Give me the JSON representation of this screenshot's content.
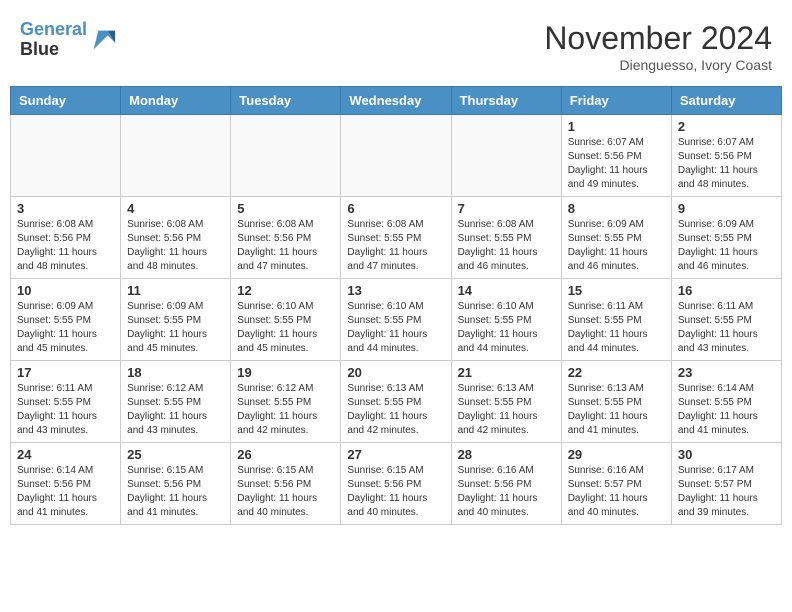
{
  "header": {
    "logo_line1": "General",
    "logo_line2": "Blue",
    "month": "November 2024",
    "location": "Dienguesso, Ivory Coast"
  },
  "weekdays": [
    "Sunday",
    "Monday",
    "Tuesday",
    "Wednesday",
    "Thursday",
    "Friday",
    "Saturday"
  ],
  "weeks": [
    [
      {
        "day": "",
        "empty": true
      },
      {
        "day": "",
        "empty": true
      },
      {
        "day": "",
        "empty": true
      },
      {
        "day": "",
        "empty": true
      },
      {
        "day": "",
        "empty": true
      },
      {
        "day": "1",
        "sunrise": "6:07 AM",
        "sunset": "5:56 PM",
        "daylight": "11 hours and 49 minutes."
      },
      {
        "day": "2",
        "sunrise": "6:07 AM",
        "sunset": "5:56 PM",
        "daylight": "11 hours and 48 minutes."
      }
    ],
    [
      {
        "day": "3",
        "sunrise": "6:08 AM",
        "sunset": "5:56 PM",
        "daylight": "11 hours and 48 minutes."
      },
      {
        "day": "4",
        "sunrise": "6:08 AM",
        "sunset": "5:56 PM",
        "daylight": "11 hours and 48 minutes."
      },
      {
        "day": "5",
        "sunrise": "6:08 AM",
        "sunset": "5:56 PM",
        "daylight": "11 hours and 47 minutes."
      },
      {
        "day": "6",
        "sunrise": "6:08 AM",
        "sunset": "5:55 PM",
        "daylight": "11 hours and 47 minutes."
      },
      {
        "day": "7",
        "sunrise": "6:08 AM",
        "sunset": "5:55 PM",
        "daylight": "11 hours and 46 minutes."
      },
      {
        "day": "8",
        "sunrise": "6:09 AM",
        "sunset": "5:55 PM",
        "daylight": "11 hours and 46 minutes."
      },
      {
        "day": "9",
        "sunrise": "6:09 AM",
        "sunset": "5:55 PM",
        "daylight": "11 hours and 46 minutes."
      }
    ],
    [
      {
        "day": "10",
        "sunrise": "6:09 AM",
        "sunset": "5:55 PM",
        "daylight": "11 hours and 45 minutes."
      },
      {
        "day": "11",
        "sunrise": "6:09 AM",
        "sunset": "5:55 PM",
        "daylight": "11 hours and 45 minutes."
      },
      {
        "day": "12",
        "sunrise": "6:10 AM",
        "sunset": "5:55 PM",
        "daylight": "11 hours and 45 minutes."
      },
      {
        "day": "13",
        "sunrise": "6:10 AM",
        "sunset": "5:55 PM",
        "daylight": "11 hours and 44 minutes."
      },
      {
        "day": "14",
        "sunrise": "6:10 AM",
        "sunset": "5:55 PM",
        "daylight": "11 hours and 44 minutes."
      },
      {
        "day": "15",
        "sunrise": "6:11 AM",
        "sunset": "5:55 PM",
        "daylight": "11 hours and 44 minutes."
      },
      {
        "day": "16",
        "sunrise": "6:11 AM",
        "sunset": "5:55 PM",
        "daylight": "11 hours and 43 minutes."
      }
    ],
    [
      {
        "day": "17",
        "sunrise": "6:11 AM",
        "sunset": "5:55 PM",
        "daylight": "11 hours and 43 minutes."
      },
      {
        "day": "18",
        "sunrise": "6:12 AM",
        "sunset": "5:55 PM",
        "daylight": "11 hours and 43 minutes."
      },
      {
        "day": "19",
        "sunrise": "6:12 AM",
        "sunset": "5:55 PM",
        "daylight": "11 hours and 42 minutes."
      },
      {
        "day": "20",
        "sunrise": "6:13 AM",
        "sunset": "5:55 PM",
        "daylight": "11 hours and 42 minutes."
      },
      {
        "day": "21",
        "sunrise": "6:13 AM",
        "sunset": "5:55 PM",
        "daylight": "11 hours and 42 minutes."
      },
      {
        "day": "22",
        "sunrise": "6:13 AM",
        "sunset": "5:55 PM",
        "daylight": "11 hours and 41 minutes."
      },
      {
        "day": "23",
        "sunrise": "6:14 AM",
        "sunset": "5:55 PM",
        "daylight": "11 hours and 41 minutes."
      }
    ],
    [
      {
        "day": "24",
        "sunrise": "6:14 AM",
        "sunset": "5:56 PM",
        "daylight": "11 hours and 41 minutes."
      },
      {
        "day": "25",
        "sunrise": "6:15 AM",
        "sunset": "5:56 PM",
        "daylight": "11 hours and 41 minutes."
      },
      {
        "day": "26",
        "sunrise": "6:15 AM",
        "sunset": "5:56 PM",
        "daylight": "11 hours and 40 minutes."
      },
      {
        "day": "27",
        "sunrise": "6:15 AM",
        "sunset": "5:56 PM",
        "daylight": "11 hours and 40 minutes."
      },
      {
        "day": "28",
        "sunrise": "6:16 AM",
        "sunset": "5:56 PM",
        "daylight": "11 hours and 40 minutes."
      },
      {
        "day": "29",
        "sunrise": "6:16 AM",
        "sunset": "5:57 PM",
        "daylight": "11 hours and 40 minutes."
      },
      {
        "day": "30",
        "sunrise": "6:17 AM",
        "sunset": "5:57 PM",
        "daylight": "11 hours and 39 minutes."
      }
    ]
  ],
  "labels": {
    "sunrise_prefix": "Sunrise: ",
    "sunset_prefix": "Sunset: ",
    "daylight_prefix": "Daylight: "
  }
}
